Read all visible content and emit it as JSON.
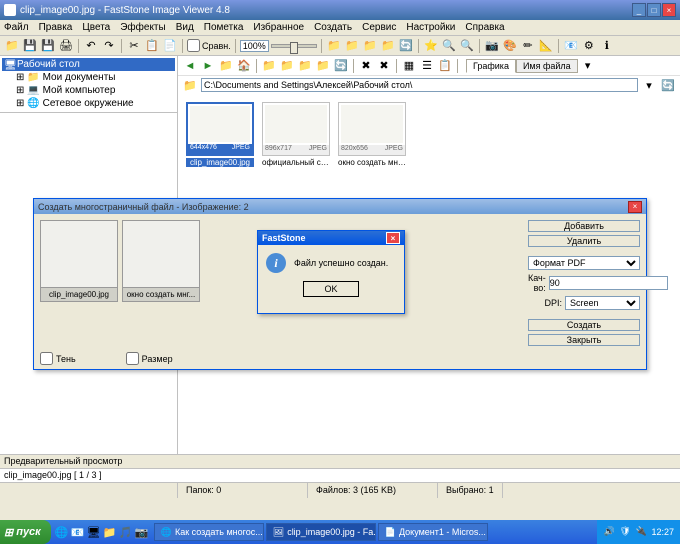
{
  "titlebar": {
    "title": "clip_image00.jpg  -  FastStone Image Viewer 4.8"
  },
  "menu": [
    "Файл",
    "Правка",
    "Цвета",
    "Эффекты",
    "Вид",
    "Пометка",
    "Избранное",
    "Создать",
    "Сервис",
    "Настройки",
    "Справка"
  ],
  "zoom": "100%",
  "compare": "Сравн.",
  "nav": {
    "tab_graphics": "Графика",
    "tab_filename": "Имя файла"
  },
  "path": "C:\\Documents and Settings\\Алексей\\Рабочий стол\\",
  "tree": {
    "root": "Рабочий стол",
    "items": [
      "Мои документы",
      "Мой компьютер",
      "Сетевое окружение"
    ]
  },
  "thumbs": [
    {
      "dim": "644x476",
      "fmt": "JPEG",
      "name": "clip_image00.jpg",
      "sel": true
    },
    {
      "dim": "896x717",
      "fmt": "JPEG",
      "name": "официальный сайт.jpg",
      "sel": false
    },
    {
      "dim": "820x656",
      "fmt": "JPEG",
      "name": "окно создать многос...",
      "sel": false
    }
  ],
  "dialog": {
    "title": "Создать многостраничный файл  -  Изображение: 2",
    "thumbs": [
      "clip_image00.jpg",
      "окно создать мнг..."
    ],
    "btn_add": "Добавить",
    "btn_del": "Удалить",
    "lbl_format": "Формат PDF",
    "lbl_quality": "Кач-во:",
    "val_quality": "90",
    "lbl_dpi": "DPI:",
    "val_dpi": "Screen",
    "btn_create": "Создать",
    "btn_close": "Закрыть",
    "chk_shadow": "Тень",
    "chk_size": "Размер"
  },
  "msgbox": {
    "title": "FastStone",
    "text": "Файл успешно создан.",
    "ok": "OK"
  },
  "preview_label": "Предварительный просмотр",
  "current_file": "clip_image00.jpg  [ 1 / 3 ]",
  "status": {
    "folders": "Папок: 0",
    "files": "Файлов: 3 (165 KB)",
    "selected": "Выбрано: 1"
  },
  "taskbar": {
    "start": "пуск",
    "tasks": [
      "Как создать многос...",
      "clip_image00.jpg - Fa...",
      "Документ1 - Micros..."
    ],
    "clock": "12:27"
  }
}
